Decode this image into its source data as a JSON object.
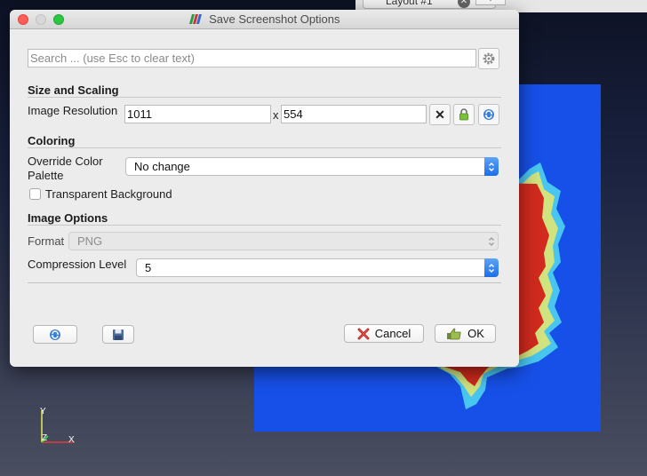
{
  "background": {
    "layout_tab_label": "Layout #1",
    "layout_tab_close": "✕",
    "layout_tab_add": "+",
    "axes": {
      "y_label": "Y",
      "z_label": "Z",
      "x_label": "X"
    }
  },
  "dialog": {
    "title": "Save Screenshot Options",
    "search": {
      "placeholder": "Search ... (use Esc to clear text)",
      "value": ""
    },
    "sections": {
      "size_and_scaling": {
        "title": "Size and Scaling",
        "image_resolution_label": "Image Resolution",
        "width": "1011",
        "height": "554",
        "times": "x",
        "reset_glyph": "✕"
      },
      "coloring": {
        "title": "Coloring",
        "override_palette_label_line1": "Override Color",
        "override_palette_label_line2": "Palette",
        "override_palette_value": "No change",
        "transparent_background_label": "Transparent Background",
        "transparent_background_checked": false
      },
      "image_options": {
        "title": "Image Options",
        "format_label": "Format",
        "format_value": "PNG",
        "compression_label": "Compression Level",
        "compression_value": "5"
      }
    },
    "buttons": {
      "cancel": "Cancel",
      "ok": "OK"
    },
    "colors": {
      "accent": "#1b6ee8",
      "close_red": "#fd5f57",
      "zoom_green": "#2ac840",
      "render_blue": "#1750e8",
      "fractal_red": "#d22a1e"
    }
  }
}
